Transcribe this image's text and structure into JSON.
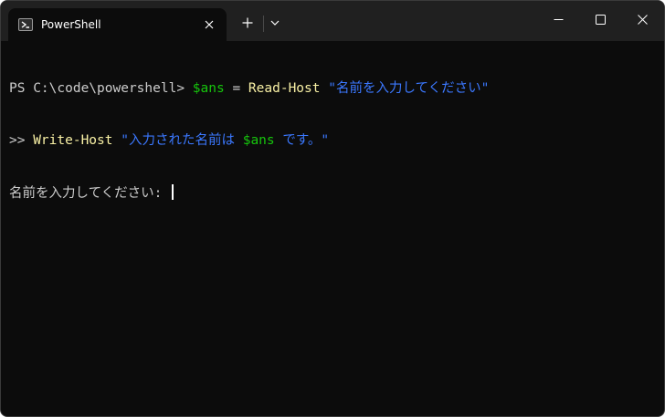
{
  "tab": {
    "title": "PowerShell",
    "icon": "powershell-icon"
  },
  "toolbar": {
    "new_tab_icon": "plus-icon",
    "dropdown_icon": "chevron-down-icon"
  },
  "window_controls": {
    "minimize_icon": "minimize-icon",
    "maximize_icon": "maximize-icon",
    "close_icon": "close-icon"
  },
  "terminal": {
    "line1": {
      "prompt": "PS C:\\code\\powershell> ",
      "var": "$ans",
      "op": " = ",
      "cmd": "Read-Host",
      "sp": " ",
      "str": "\"名前を入力してください\""
    },
    "line2": {
      "prompt": ">> ",
      "cmd": "Write-Host",
      "sp": " ",
      "str1": "\"入力された名前は ",
      "var": "$ans",
      "str2": " です。\""
    },
    "line3": {
      "text": "名前を入力してください: "
    }
  },
  "colors": {
    "background": "#0c0c0c",
    "titlebar": "#202020",
    "variable": "#16c60c",
    "command": "#f9f1a5",
    "string": "#3b78ff",
    "text": "#cccccc"
  }
}
